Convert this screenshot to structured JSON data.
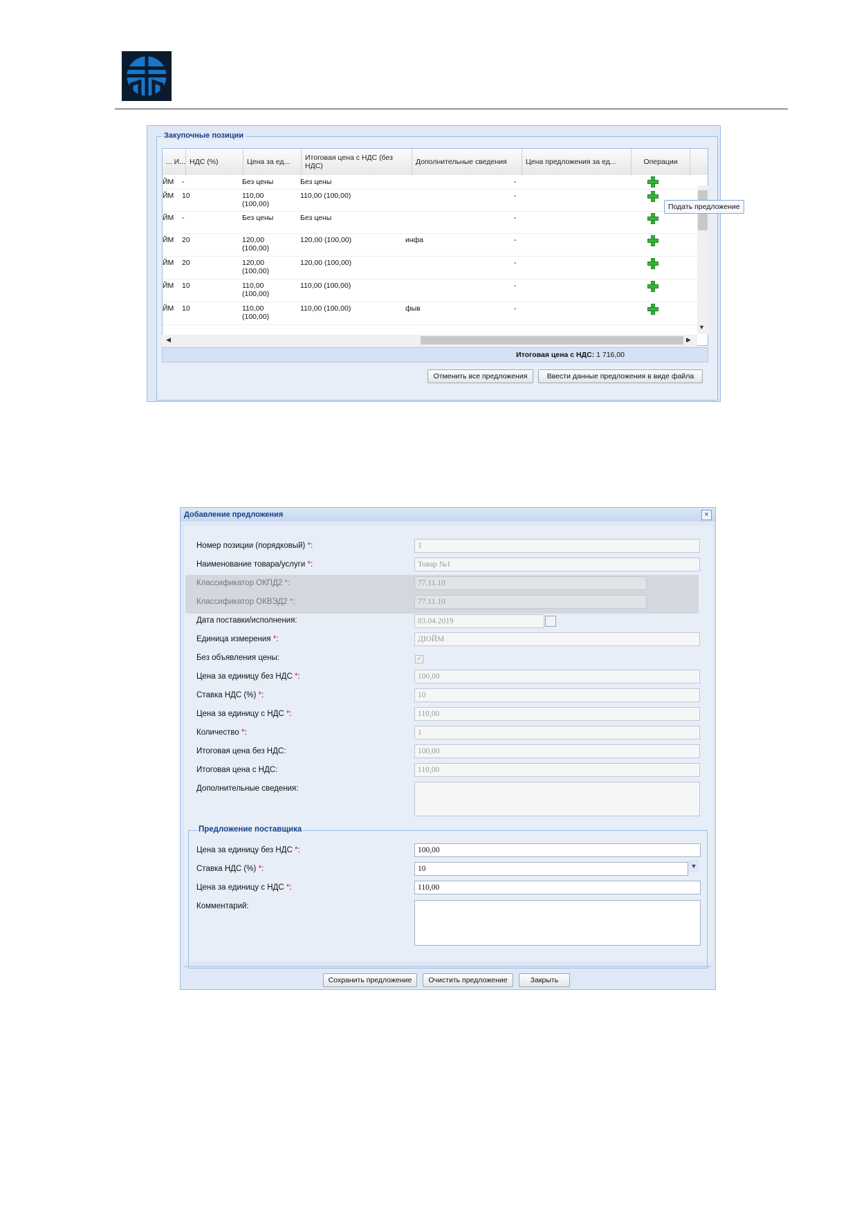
{
  "colors": {
    "accent": "#15428b",
    "panel_bg": "#dfe8f6",
    "border": "#99bbe8",
    "required": "#d21b1b",
    "plus": "#35b43a"
  },
  "logo": {
    "icon": "tree-emblem-logo"
  },
  "panel1": {
    "legend": "Закупочные позиции",
    "columns": [
      "... И...",
      "НДС (%)",
      "Цена за ед...",
      "Итоговая цена с НДС (без НДС)",
      "Дополнительные сведения",
      "Цена предложения за ед...",
      "Операции"
    ],
    "rows": [
      {
        "unit": "ЙМ",
        "vat": "-",
        "price": "Без цены",
        "total": "Без цены",
        "info": "",
        "offer": "-"
      },
      {
        "unit": "ЙМ",
        "vat": "10",
        "price": "110,00 (100,00)",
        "total": "110,00 (100,00)",
        "info": "",
        "offer": "-"
      },
      {
        "unit": "ЙМ",
        "vat": "-",
        "price": "Без цены",
        "total": "Без цены",
        "info": "",
        "offer": "-"
      },
      {
        "unit": "ЙМ",
        "vat": "20",
        "price": "120,00 (100,00)",
        "total": "120,00 (100,00)",
        "info": "инфа",
        "offer": "-"
      },
      {
        "unit": "ЙМ",
        "vat": "20",
        "price": "120,00 (100,00)",
        "total": "120,00 (100,00)",
        "info": "",
        "offer": "-"
      },
      {
        "unit": "ЙМ",
        "vat": "10",
        "price": "110,00 (100,00)",
        "total": "110,00 (100,00)",
        "info": "",
        "offer": "-"
      },
      {
        "unit": "ЙМ",
        "vat": "10",
        "price": "110,00 (100,00)",
        "total": "110,00 (100,00)",
        "info": "фыв",
        "offer": "-"
      }
    ],
    "tooltip": "Подать предложение",
    "total_label": "Итоговая цена с НДС:",
    "total_value": "1 716,00",
    "btn_cancel_all": "Отменить все предложения",
    "btn_upload_file": "Ввести данные предложения в виде файла"
  },
  "dialog": {
    "title": "Добавление предложения",
    "close": "×",
    "fields": {
      "pos_num": {
        "label": "Номер позиции (порядковый)",
        "value": "1"
      },
      "name": {
        "label": "Наименование товара/услуги",
        "value": "Товар №1"
      },
      "okpd2": {
        "label": "Классификатор ОКПД2",
        "value": "77.11.10"
      },
      "okved2": {
        "label": "Классификатор ОКВЭД2",
        "value": "77.11.10"
      },
      "date": {
        "label": "Дата поставки/исполнения:",
        "value": "03.04.2019"
      },
      "unit": {
        "label": "Единица измерения",
        "value": "ДЮЙМ"
      },
      "no_price": {
        "label": "Без объявления цены:",
        "value": "✓"
      },
      "price_no_vat": {
        "label": "Цена за единицу без НДС",
        "value": "100,00"
      },
      "vat_rate": {
        "label": "Ставка НДС (%)",
        "value": "10"
      },
      "price_vat": {
        "label": "Цена за единицу с НДС",
        "value": "110,00"
      },
      "qty": {
        "label": "Количество",
        "value": "1"
      },
      "total_no_vat": {
        "label": "Итоговая цена без НДС:",
        "value": "100,00"
      },
      "total_vat": {
        "label": "Итоговая цена с НДС:",
        "value": "110,00"
      },
      "extra": {
        "label": "Дополнительные сведения:",
        "value": ""
      }
    },
    "req_mark": "*",
    "colon": ":",
    "supplier": {
      "legend": "Предложение поставщика",
      "price_no_vat": {
        "label": "Цена за единицу без НДС",
        "value": "100,00"
      },
      "vat_rate": {
        "label": "Ставка НДС (%)",
        "value": "10"
      },
      "price_vat": {
        "label": "Цена за единицу с НДС",
        "value": "110,00"
      },
      "comment": {
        "label": "Комментарий:",
        "value": ""
      }
    },
    "btn_save": "Сохранить предложение",
    "btn_clear": "Очистить предложение",
    "btn_close": "Закрыть"
  }
}
